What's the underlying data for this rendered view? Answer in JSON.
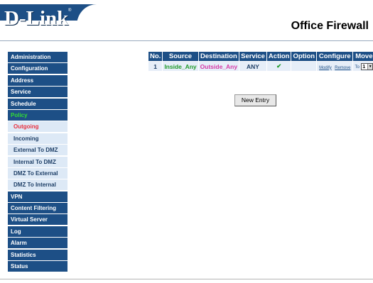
{
  "brand": {
    "logo_text": "D-Link",
    "logo_mark": "®",
    "product_title": "Office Firewall"
  },
  "sidebar": {
    "items": [
      {
        "label": "Administration"
      },
      {
        "label": "Configuration"
      },
      {
        "label": "Address"
      },
      {
        "label": "Service"
      },
      {
        "label": "Schedule"
      },
      {
        "label": "Policy",
        "active": true
      }
    ],
    "policy_subitems": [
      {
        "label": "Outgoing",
        "active": true
      },
      {
        "label": "Incoming"
      },
      {
        "label": "External To DMZ"
      },
      {
        "label": "Internal To DMZ"
      },
      {
        "label": "DMZ To External"
      },
      {
        "label": "DMZ To Internal"
      }
    ],
    "items_after": [
      {
        "label": "VPN"
      },
      {
        "label": "Content Filtering"
      },
      {
        "label": "Virtual Server"
      },
      {
        "label": "Log"
      },
      {
        "label": "Alarm"
      },
      {
        "label": "Statistics"
      },
      {
        "label": "Status"
      }
    ]
  },
  "policy_table": {
    "headers": [
      "No.",
      "Source",
      "Destination",
      "Service",
      "Action",
      "Option",
      "Configure",
      "Move"
    ],
    "rows": [
      {
        "no": "1",
        "source": "Inside_Any",
        "destination": "Outside_Any",
        "service": "ANY",
        "action_icon": "checkmark-icon",
        "action_glyph": "✔",
        "option": "",
        "configure_modify": "Modify",
        "configure_remove": "Remove",
        "move_to_label": "To",
        "move_value": "1",
        "move_arrow": "▼"
      }
    ]
  },
  "buttons": {
    "new_entry": "New Entry"
  },
  "colors": {
    "nav_bg": "#1d4f86",
    "subnav_bg": "#dde9f6",
    "active_nav": "#33dd33",
    "active_subnav": "#e8313f",
    "source_text": "#1f9a2a",
    "destination_text": "#d63aa6"
  }
}
